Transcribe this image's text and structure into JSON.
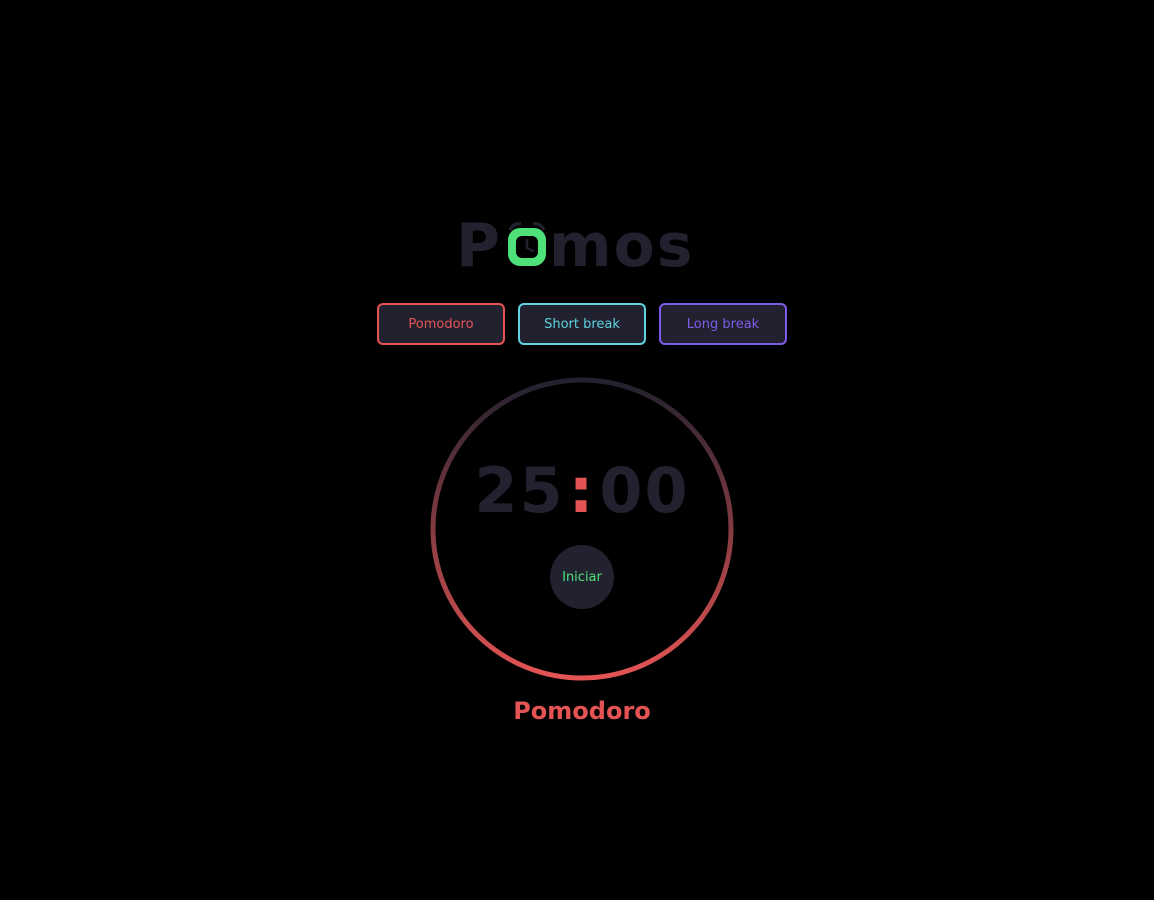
{
  "logo": {
    "prefix": "P",
    "suffix": "mos",
    "icon": "alarm-clock-icon",
    "icon_color": "#4ee17a",
    "text_color": "#22212f"
  },
  "modes": [
    {
      "label": "Pomodoro",
      "color": "#e55454"
    },
    {
      "label": "Short break",
      "color": "#5fd3e0"
    },
    {
      "label": "Long break",
      "color": "#7c5ce6"
    }
  ],
  "timer": {
    "minutes": "25",
    "separator": ":",
    "seconds": "00",
    "progress": 1.0,
    "ring_gradient": [
      "#22212f",
      "#e55454"
    ]
  },
  "start_button": {
    "label": "Iniciar",
    "color": "#4ee17a"
  },
  "current_mode": {
    "label": "Pomodoro",
    "color": "#e55454"
  }
}
